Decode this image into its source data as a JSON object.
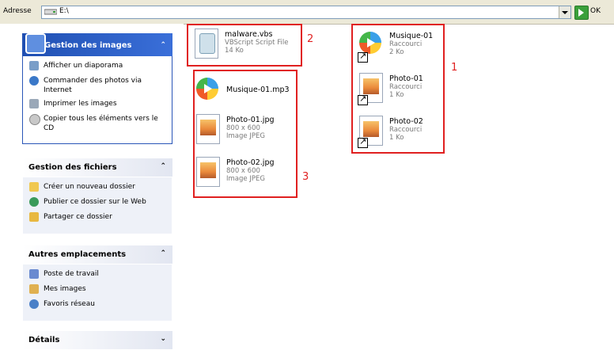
{
  "address": {
    "label": "Adresse",
    "value": "E:\\",
    "go_label": "OK"
  },
  "sidebar": {
    "image_tasks": {
      "title": "Gestion des images",
      "items": [
        {
          "label": "Afficher un diaporama",
          "icon": "slideshow-icon"
        },
        {
          "label": "Commander des photos via Internet",
          "icon": "order-photos-icon"
        },
        {
          "label": "Imprimer les images",
          "icon": "print-icon"
        },
        {
          "label": "Copier tous les éléments vers le CD",
          "icon": "cd-icon"
        }
      ]
    },
    "file_tasks": {
      "title": "Gestion des fichiers",
      "items": [
        {
          "label": "Créer un nouveau dossier",
          "icon": "new-folder-icon"
        },
        {
          "label": "Publier ce dossier sur le Web",
          "icon": "web-publish-icon"
        },
        {
          "label": "Partager ce dossier",
          "icon": "share-folder-icon"
        }
      ]
    },
    "other_places": {
      "title": "Autres emplacements",
      "items": [
        {
          "label": "Poste de travail",
          "icon": "my-computer-icon"
        },
        {
          "label": "Mes images",
          "icon": "my-pictures-icon"
        },
        {
          "label": "Favoris réseau",
          "icon": "network-places-icon"
        }
      ]
    },
    "details": {
      "title": "Détails"
    }
  },
  "files": {
    "malware": {
      "name": "malware.vbs",
      "type": "VBScript Script File",
      "size": "14 Ko"
    },
    "musique_mp3": {
      "name": "Musique-01.mp3"
    },
    "photo01_jpg": {
      "name": "Photo-01.jpg",
      "dims": "800 x 600",
      "type": "Image JPEG"
    },
    "photo02_jpg": {
      "name": "Photo-02.jpg",
      "dims": "800 x 600",
      "type": "Image JPEG"
    },
    "musique_lnk": {
      "name": "Musique-01",
      "type": "Raccourci",
      "size": "2 Ko"
    },
    "photo01_lnk": {
      "name": "Photo-01",
      "type": "Raccourci",
      "size": "1 Ko"
    },
    "photo02_lnk": {
      "name": "Photo-02",
      "type": "Raccourci",
      "size": "1 Ko"
    }
  },
  "annotations": {
    "box1": "1",
    "box2": "2",
    "box3": "3"
  },
  "colors": {
    "annotation_red": "#e02020",
    "task_blue": "#1f4fb2"
  }
}
